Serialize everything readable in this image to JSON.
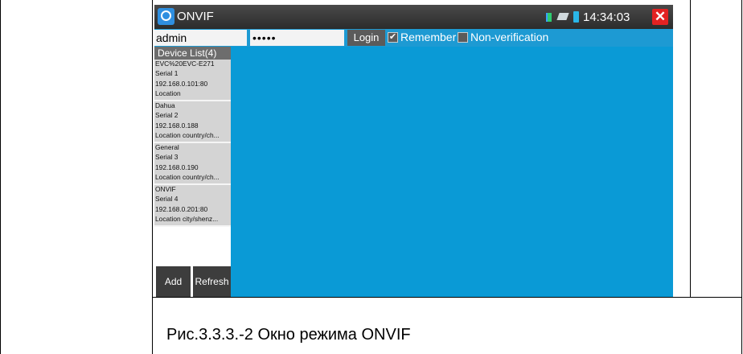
{
  "app": {
    "title": "ONVIF",
    "clock": "14:34:03",
    "close_label": "✕"
  },
  "login": {
    "username": "admin",
    "password": "•••••",
    "login_label": "Login",
    "remember_label": "Remember",
    "remember_checked": "✔",
    "nonverification_label": "Non-verification"
  },
  "device_list": {
    "header": "Device List(4)",
    "devices": [
      {
        "name": "EVC%20EVC-E271",
        "serial": "Serial 1",
        "address": "192.168.0.101:80",
        "location": "Location"
      },
      {
        "name": "Dahua",
        "serial": "Serial 2",
        "address": "192.168.0.188",
        "location": "Location country/ch..."
      },
      {
        "name": "General",
        "serial": "Serial 3",
        "address": "192.168.0.190",
        "location": "Location country/ch..."
      },
      {
        "name": "ONVIF",
        "serial": "Serial 4",
        "address": "192.168.0.201:80",
        "location": "Location city/shenz..."
      }
    ],
    "add_label": "Add",
    "refresh_label": "Refresh"
  },
  "caption": "Рис.3.3.3.-2  Окно режима ONVIF",
  "colors": {
    "main_area": "#0a9ad6",
    "title_bar": "#2c2c2c",
    "close": "#e32222"
  }
}
